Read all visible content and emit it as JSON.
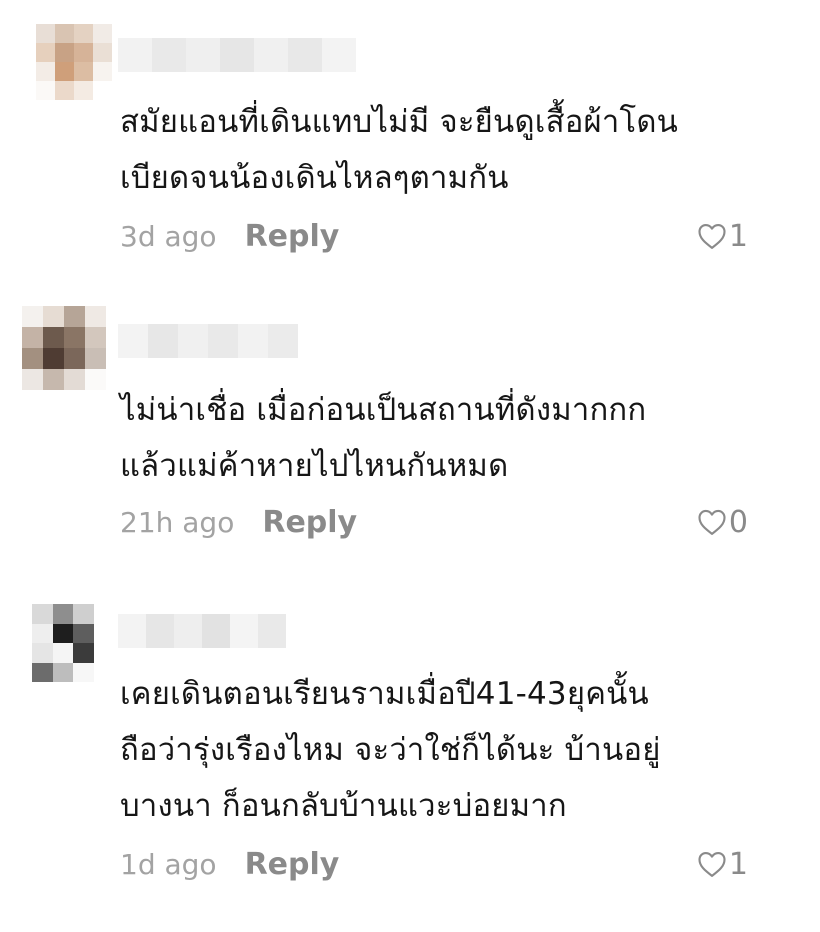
{
  "comments": [
    {
      "text": "สมัยแอนที่เดินแทบไม่มี จะยืนดูเสื้อผ้าโดน\nเบียดจนน้องเดินไหลๆตามกัน",
      "time": "3d ago",
      "reply_label": "Reply",
      "likes": "1"
    },
    {
      "text": "ไม่น่าเชื่อ เมื่อก่อนเป็นสถานที่ดังมากกก\nแล้วแม่ค้าหายไปไหนกันหมด",
      "time": "21h ago",
      "reply_label": "Reply",
      "likes": "0"
    },
    {
      "text": "เคยเดินตอนเรียนรามเมื่อปี41-43ยุคนั้น\nถือว่ารุ่งเรืองไหม จะว่าใช่ก็ได้นะ บ้านอยู่\nบางนา ก็อนกลับบ้านแวะบ่อยมาก",
      "time": "1d ago",
      "reply_label": "Reply",
      "likes": "1"
    }
  ],
  "icons": {
    "like": "heart-outline-icon"
  },
  "colors": {
    "text": "#161616",
    "time": "#a3a3a3",
    "reply": "#8a8a8a",
    "icon": "#8a8a8a"
  }
}
